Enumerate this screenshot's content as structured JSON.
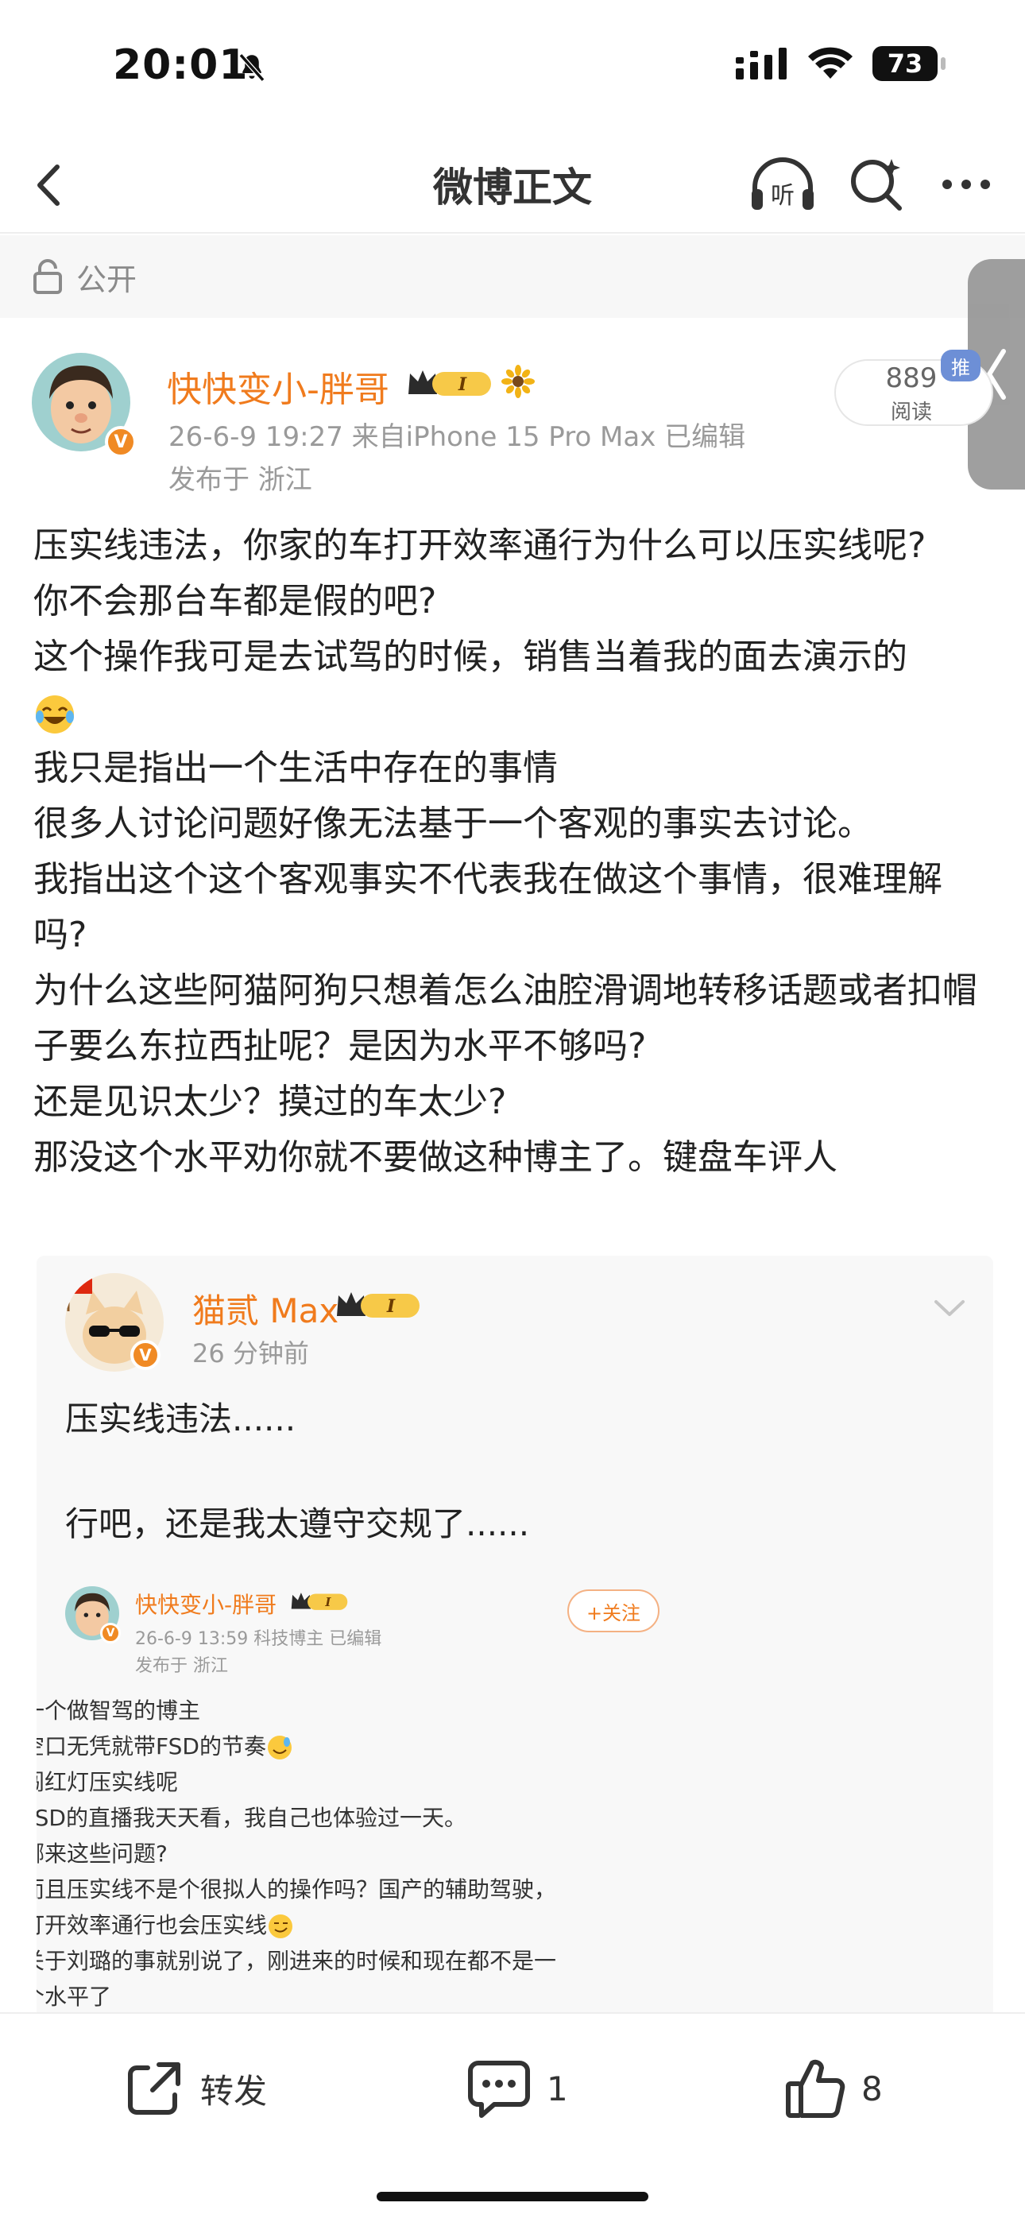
{
  "status_bar": {
    "time": "20:01",
    "battery": "73"
  },
  "nav": {
    "title": "微博正文"
  },
  "visibility": {
    "label": "公开"
  },
  "post": {
    "author": "快快变小-胖哥",
    "vip_level": "I",
    "meta": "26-6-9 19:27  来自iPhone 15 Pro Max  已编辑",
    "location": "发布于 浙江",
    "read_count": "889",
    "read_label": "阅读",
    "push_tag": "推",
    "body": [
      "压实线违法，你家的车打开效率通行为什么可以压实线呢?",
      "你不会那台车都是假的吧?",
      "这个操作我可是去试驾的时候，销售当着我的面去演示的",
      "我只是指出一个生活中存在的事情",
      "很多人讨论问题好像无法基于一个客观的事实去讨论。",
      "我指出这个这个客观事实不代表我在做这个事情，很难理解吗?",
      "为什么这些阿猫阿狗只想着怎么油腔滑调地转移话题或者扣帽子要么东拉西扯呢？是因为水平不够吗?",
      "还是见识太少？摸过的车太少?",
      "那没这个水平劝你就不要做这种博主了。键盘车评人"
    ]
  },
  "quote": {
    "author": "猫贰 Max",
    "vip_level": "I",
    "time": "26 分钟前",
    "text1": "压实线违法......",
    "text2": "行吧，还是我太遵守交规了......",
    "embed": {
      "author": "快快变小-胖哥",
      "vip_level": "I",
      "meta": "26-6-9 13:59  科技博主  已编辑",
      "location": "发布于 浙江",
      "follow_label": "+关注",
      "lines": [
        "一个做智驾的博主",
        "空口无凭就带FSD的节奏",
        "闯红灯压实线呢",
        "FSD的直播我天天看，我自己也体验过一天。",
        "哪来这些问题?",
        "而且压实线不是个很拟人的操作吗？国产的辅助驾驶，",
        "打开效率通行也会压实线",
        "关于刘璐的事就别说了，刚进来的时候和现在都不是一",
        "个水平了"
      ]
    }
  },
  "actions": {
    "forward_label": "转发",
    "comment_count": "1",
    "like_count": "8"
  },
  "colors": {
    "accent": "#f07b1d",
    "push": "#6d8fd6"
  }
}
